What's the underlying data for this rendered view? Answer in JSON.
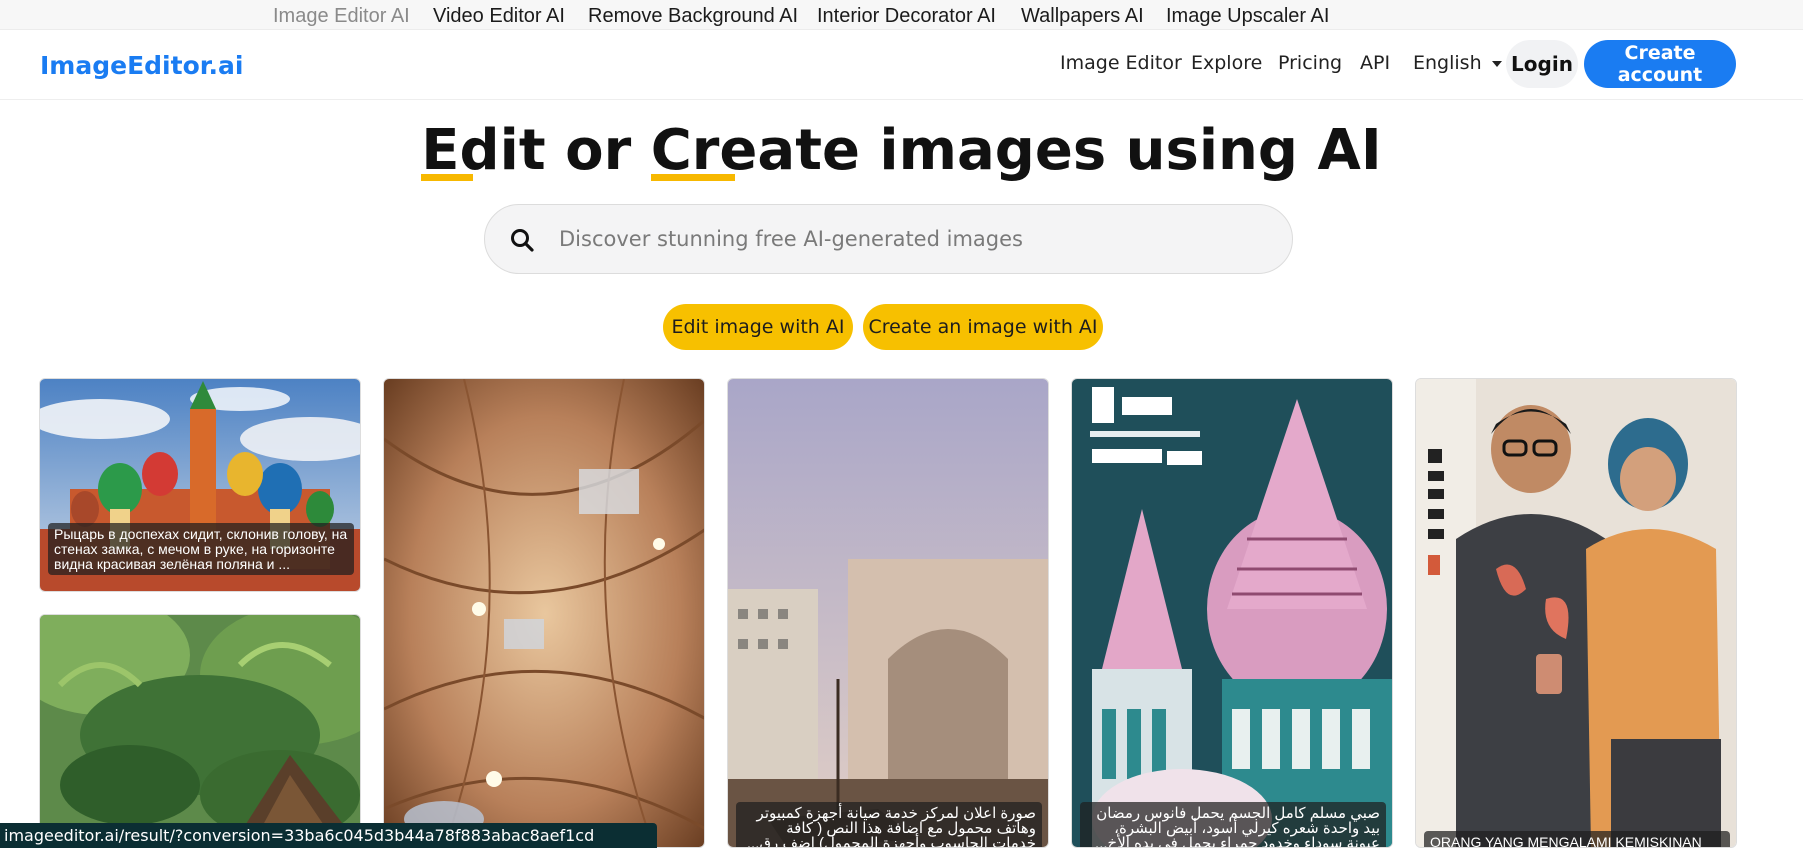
{
  "top_links": [
    {
      "label": "Image Editor AI"
    },
    {
      "label": "Video Editor AI"
    },
    {
      "label": "Remove Background AI"
    },
    {
      "label": "Interior Decorator AI"
    },
    {
      "label": "Wallpapers AI"
    },
    {
      "label": "Image Upscaler AI"
    }
  ],
  "header": {
    "logo": "ImageEditor.ai",
    "nav": [
      {
        "label": "Image Editor"
      },
      {
        "label": "Explore"
      },
      {
        "label": "Pricing"
      },
      {
        "label": "API"
      },
      {
        "label": "English"
      }
    ],
    "login_label": "Login",
    "create_account_label": "Create account"
  },
  "hero": {
    "title_part1": "Edit",
    "title_part2": " or ",
    "title_part3": "Create",
    "title_part4": " images using AI"
  },
  "search": {
    "placeholder": "Discover stunning free AI-generated images"
  },
  "actions": {
    "edit_label": "Edit image with AI",
    "create_label": "Create an image with AI"
  },
  "gallery": {
    "cards": [
      {
        "caption": "Рыцарь в доспехах сидит, склонив голову, на стенах замка, с мечом в руке, на горизонте видна красивая зелёная поляна и ..."
      },
      {
        "caption": ""
      },
      {
        "caption": "صورة اعلان لمركز خدمة صيانة أجهزة كمبيوتر وهاتف محمول مع اضافة هذا النص ( كافة خدمات الحاسوب وأجهزة المحمول) اضف رق..."
      },
      {
        "caption": "صبي مسلم كامل الجسم يحمل فانوس رمضان بيد واحدة شعره كيرلي أسود، أبيض البشرة، عيونة سوداء وخدود حمراء يحمل في يده الأخ..."
      },
      {
        "caption": "ORANG YANG MENGALAMI KEMISKINAN"
      },
      {
        "caption": ""
      }
    ]
  },
  "status_url": "imageeditor.ai/result/?conversion=33ba6c045d3b44a78f883abac8aef1cd",
  "colors": {
    "brand_blue": "#1a7cf2",
    "accent_yellow": "#f7c000"
  }
}
